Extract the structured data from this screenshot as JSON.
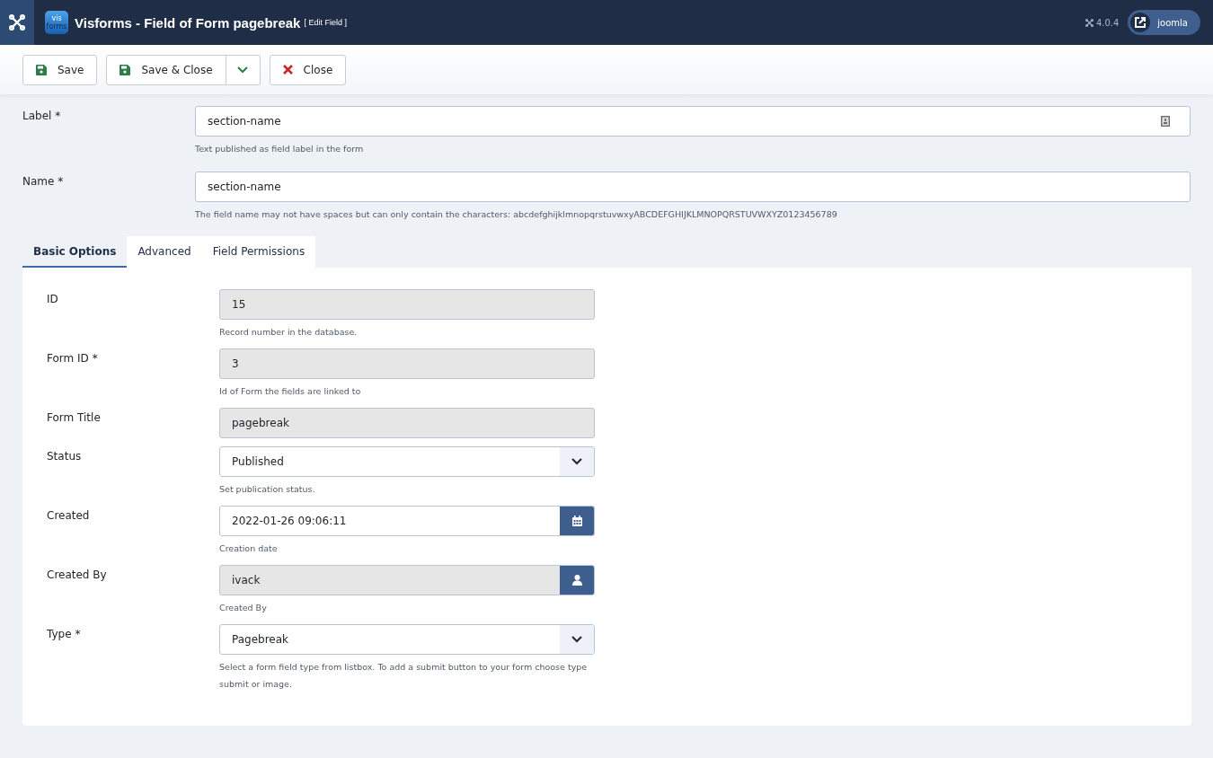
{
  "header": {
    "logo": {
      "top": "vis",
      "bottom": "forms"
    },
    "title": "Visforms - Field of Form pagebreak",
    "subtitle": "[ Edit Field ]",
    "version": "4.0.4",
    "user": "joomla"
  },
  "toolbar": [
    {
      "kind": "save",
      "label": "Save"
    },
    {
      "kind": "save-split",
      "label": "Save & Close"
    },
    {
      "kind": "close",
      "label": "Close"
    }
  ],
  "top_fields": [
    {
      "label": "Label *",
      "value": "section-name",
      "help": "Text published as field label in the form",
      "has_icon": true
    },
    {
      "label": "Name *",
      "value": "section-name",
      "help": "The field name may not have spaces but can only contain the characters: abcdefghijklmnopqrstuvwxyABCDEFGHIJKLMNOPQRSTUVWXYZ0123456789",
      "has_icon": false
    }
  ],
  "tabs": [
    {
      "label": "Basic Options",
      "selected": true
    },
    {
      "label": "Advanced",
      "selected": false
    },
    {
      "label": "Field Permissions",
      "selected": false
    }
  ],
  "fields": [
    {
      "kind": "readonly",
      "label": "ID",
      "value": "15",
      "help": "Record number in the database."
    },
    {
      "kind": "readonly",
      "label": "Form ID *",
      "value": "3",
      "help": "Id of Form the fields are linked to"
    },
    {
      "kind": "readonly",
      "label": "Form Title",
      "value": "pagebreak"
    },
    {
      "kind": "select",
      "label": "Status",
      "value": "Published",
      "help": "Set publication status."
    },
    {
      "kind": "date",
      "label": "Created",
      "value": "2022-01-26 09:06:11",
      "help": "Creation date"
    },
    {
      "kind": "user",
      "label": "Created By",
      "value": "ivack",
      "help": "Created By"
    },
    {
      "kind": "select",
      "label": "Type *",
      "value": "Pagebreak",
      "help": "Select a form field type from listbox. To add a submit button to your form choose type submit or image."
    }
  ]
}
